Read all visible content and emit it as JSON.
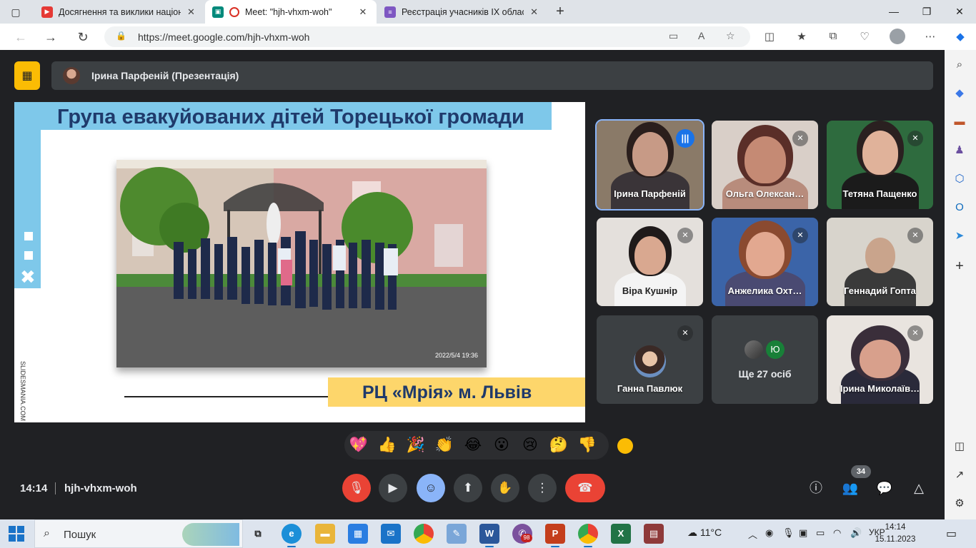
{
  "browser": {
    "tabs": [
      {
        "title": "Досягнення та виклики націона",
        "color": "#e53935",
        "glyph": "▶"
      },
      {
        "title": "Meet: \"hjh-vhxm-woh\"",
        "color": "#00897b",
        "glyph": "●"
      },
      {
        "title": "Реєстрація учасників IX обласн",
        "color": "#7e57c2",
        "glyph": "≡"
      }
    ],
    "new_tab": "+",
    "url": "https://meet.google.com/hjh-vhxm-woh",
    "window_controls": {
      "minimize": "—",
      "maximize": "❐",
      "close": "✕"
    }
  },
  "meet": {
    "presenter": "Ірина Парфеній (Презентація)",
    "slide": {
      "title": "Група евакуйованих дітей Торецької громади",
      "caption": "РЦ «Мрія» м. Львів",
      "photo_timestamp": "2022/5/4  19:36",
      "watermark": "SLIDESMANIA.COM"
    },
    "participants": [
      {
        "name": "Ірина Парфеній",
        "speaking": true
      },
      {
        "name": "Ольга Олексан…",
        "speaking": false
      },
      {
        "name": "Тетяна Пащенко",
        "speaking": false
      },
      {
        "name": "Віра Кушнір",
        "speaking": false
      },
      {
        "name": "Анжелика Охт…",
        "speaking": false
      },
      {
        "name": "Геннадий Гопта",
        "speaking": false
      },
      {
        "name": "Ганна Павлюк",
        "speaking": false
      },
      {
        "name": "Ірина Миколаїв…",
        "speaking": false
      }
    ],
    "more": {
      "label": "Ще 27 осіб",
      "initial": "Ю"
    },
    "reactions": [
      "💖",
      "👍",
      "🎉",
      "👏",
      "😂",
      "😮",
      "😢",
      "🤔",
      "👎"
    ],
    "time": "14:14",
    "code": "hjh-vhxm-woh",
    "participant_count": "34"
  },
  "taskbar": {
    "search_placeholder": "Пошук",
    "weather": "11°C",
    "lang": "УКР",
    "time": "14:14",
    "date": "15.11.2023",
    "viber_badge": "98"
  }
}
